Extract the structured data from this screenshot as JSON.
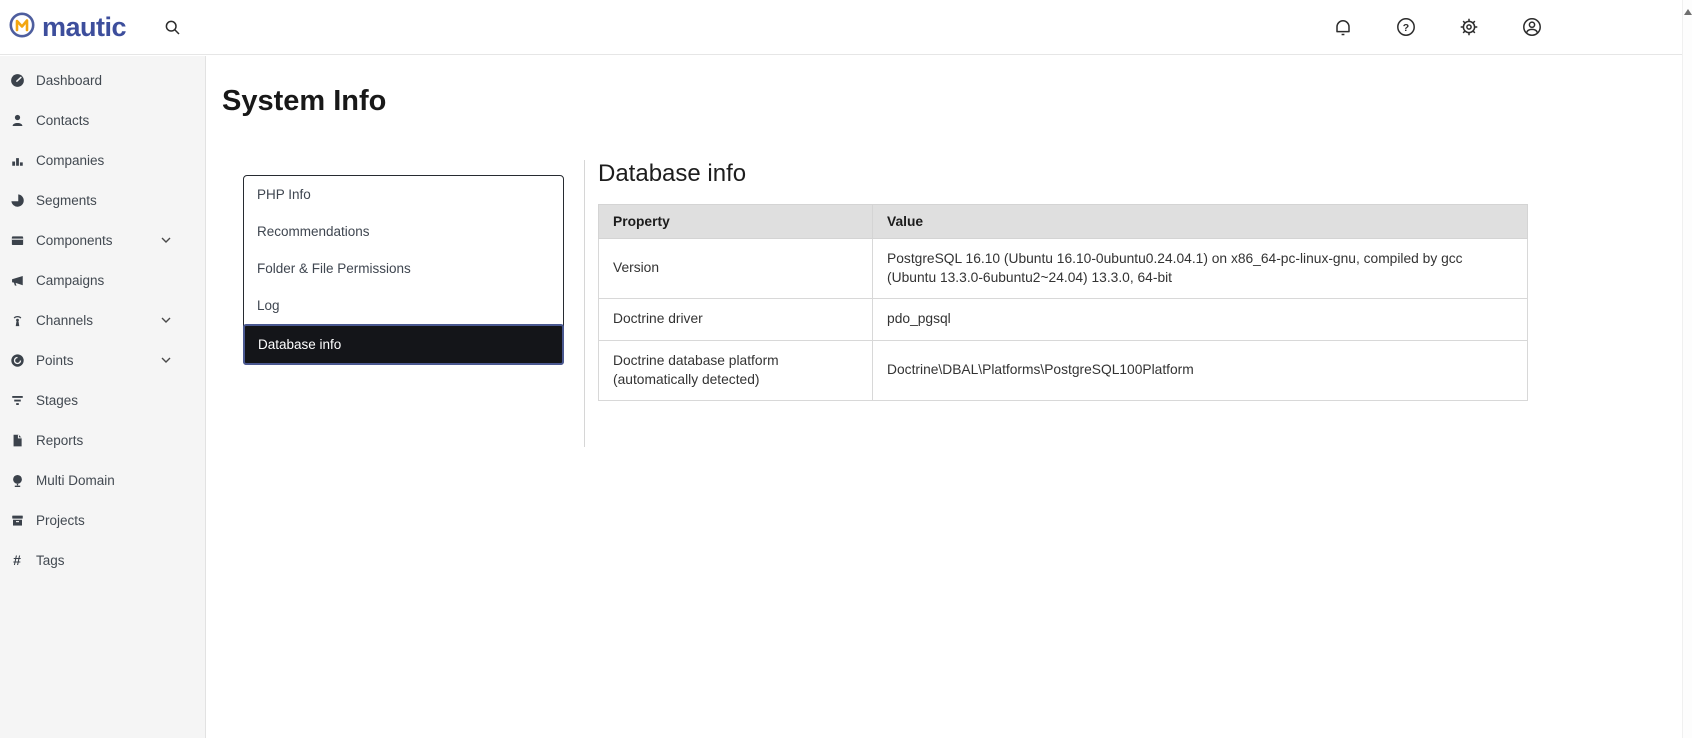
{
  "colors": {
    "brand_blue": "#4e5e9e",
    "brand_orange": "#f3a60f",
    "wordmark_blue": "#3d4e9c",
    "active_tab_bg": "#141519",
    "active_tab_border": "#4a5890",
    "table_header_bg": "#dfdfdf",
    "sidebar_bg": "#f5f5f5"
  },
  "topbar": {
    "brand": "mautic",
    "icons": [
      "search",
      "notifications",
      "help",
      "settings",
      "account"
    ]
  },
  "sidebar": {
    "items": [
      {
        "label": "Dashboard",
        "icon": "dashboard"
      },
      {
        "label": "Contacts",
        "icon": "contacts"
      },
      {
        "label": "Companies",
        "icon": "companies"
      },
      {
        "label": "Segments",
        "icon": "segments"
      },
      {
        "label": "Components",
        "icon": "components",
        "expandable": true
      },
      {
        "label": "Campaigns",
        "icon": "campaigns"
      },
      {
        "label": "Channels",
        "icon": "channels",
        "expandable": true
      },
      {
        "label": "Points",
        "icon": "points",
        "expandable": true
      },
      {
        "label": "Stages",
        "icon": "stages"
      },
      {
        "label": "Reports",
        "icon": "reports"
      },
      {
        "label": "Multi Domain",
        "icon": "multi-domain"
      },
      {
        "label": "Projects",
        "icon": "projects"
      },
      {
        "label": "Tags",
        "icon": "tags"
      }
    ]
  },
  "page": {
    "title": "System Info"
  },
  "tabs": {
    "items": [
      "PHP Info",
      "Recommendations",
      "Folder & File Permissions",
      "Log",
      "Database info"
    ],
    "active": "Database info"
  },
  "main": {
    "heading": "Database info",
    "table": {
      "headers": [
        "Property",
        "Value"
      ],
      "rows": [
        {
          "property": "Version",
          "value": "PostgreSQL 16.10 (Ubuntu 16.10-0ubuntu0.24.04.1) on x86_64-pc-linux-gnu, compiled by gcc (Ubuntu 13.3.0-6ubuntu2~24.04) 13.3.0, 64-bit"
        },
        {
          "property": "Doctrine driver",
          "value": "pdo_pgsql"
        },
        {
          "property": "Doctrine database platform (automatically detected)",
          "value": "Doctrine\\DBAL\\Platforms\\PostgreSQL100Platform"
        }
      ]
    }
  }
}
